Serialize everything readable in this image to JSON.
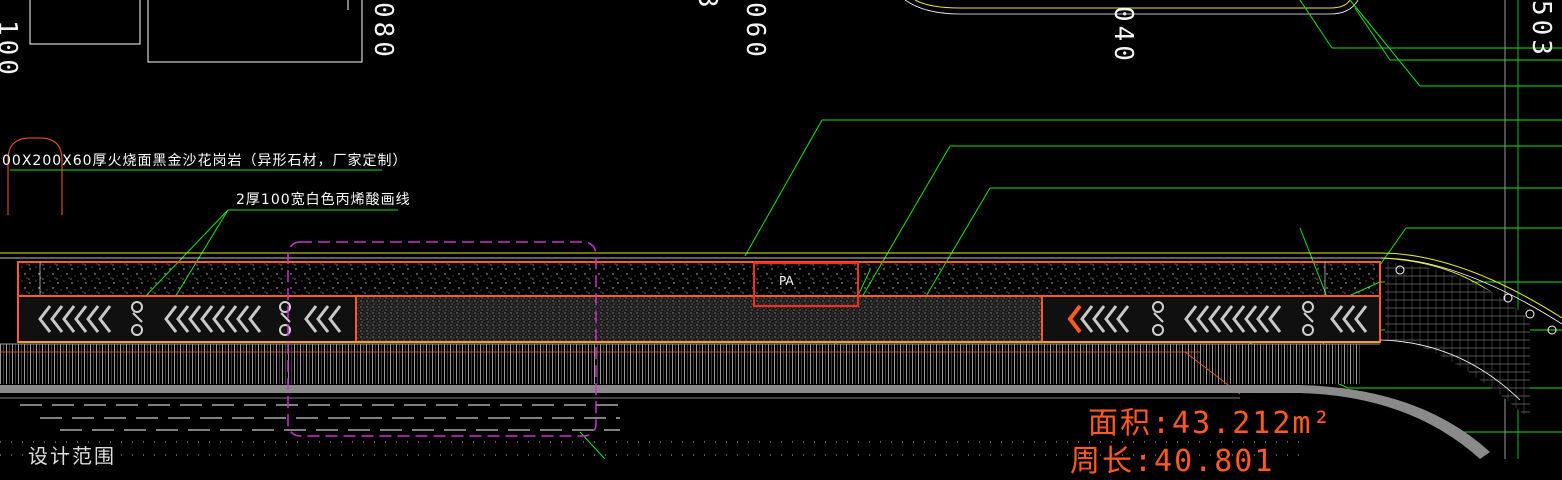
{
  "drawing": {
    "callouts": {
      "stone_spec": "00X200X60厚火烧面黑金沙花岗岩（异形石材，厂家定制）",
      "paint_line": "2厚100宽白色丙烯酸画线"
    },
    "dimensions": [
      "100",
      "080",
      "060",
      "040",
      "503",
      "3"
    ],
    "tag": "PA",
    "area_text": "面积:43.212m²",
    "area_text_partial": "周长:40.801",
    "design_range_text": "设计范围",
    "colors": {
      "background": "#000000",
      "leader": "#19e619",
      "edge": "#ff5a1f",
      "tag_box": "#ff2a1a",
      "boundary": "#cc33cc",
      "curb": "#e6e633",
      "paving": "#9a9a9a"
    }
  }
}
